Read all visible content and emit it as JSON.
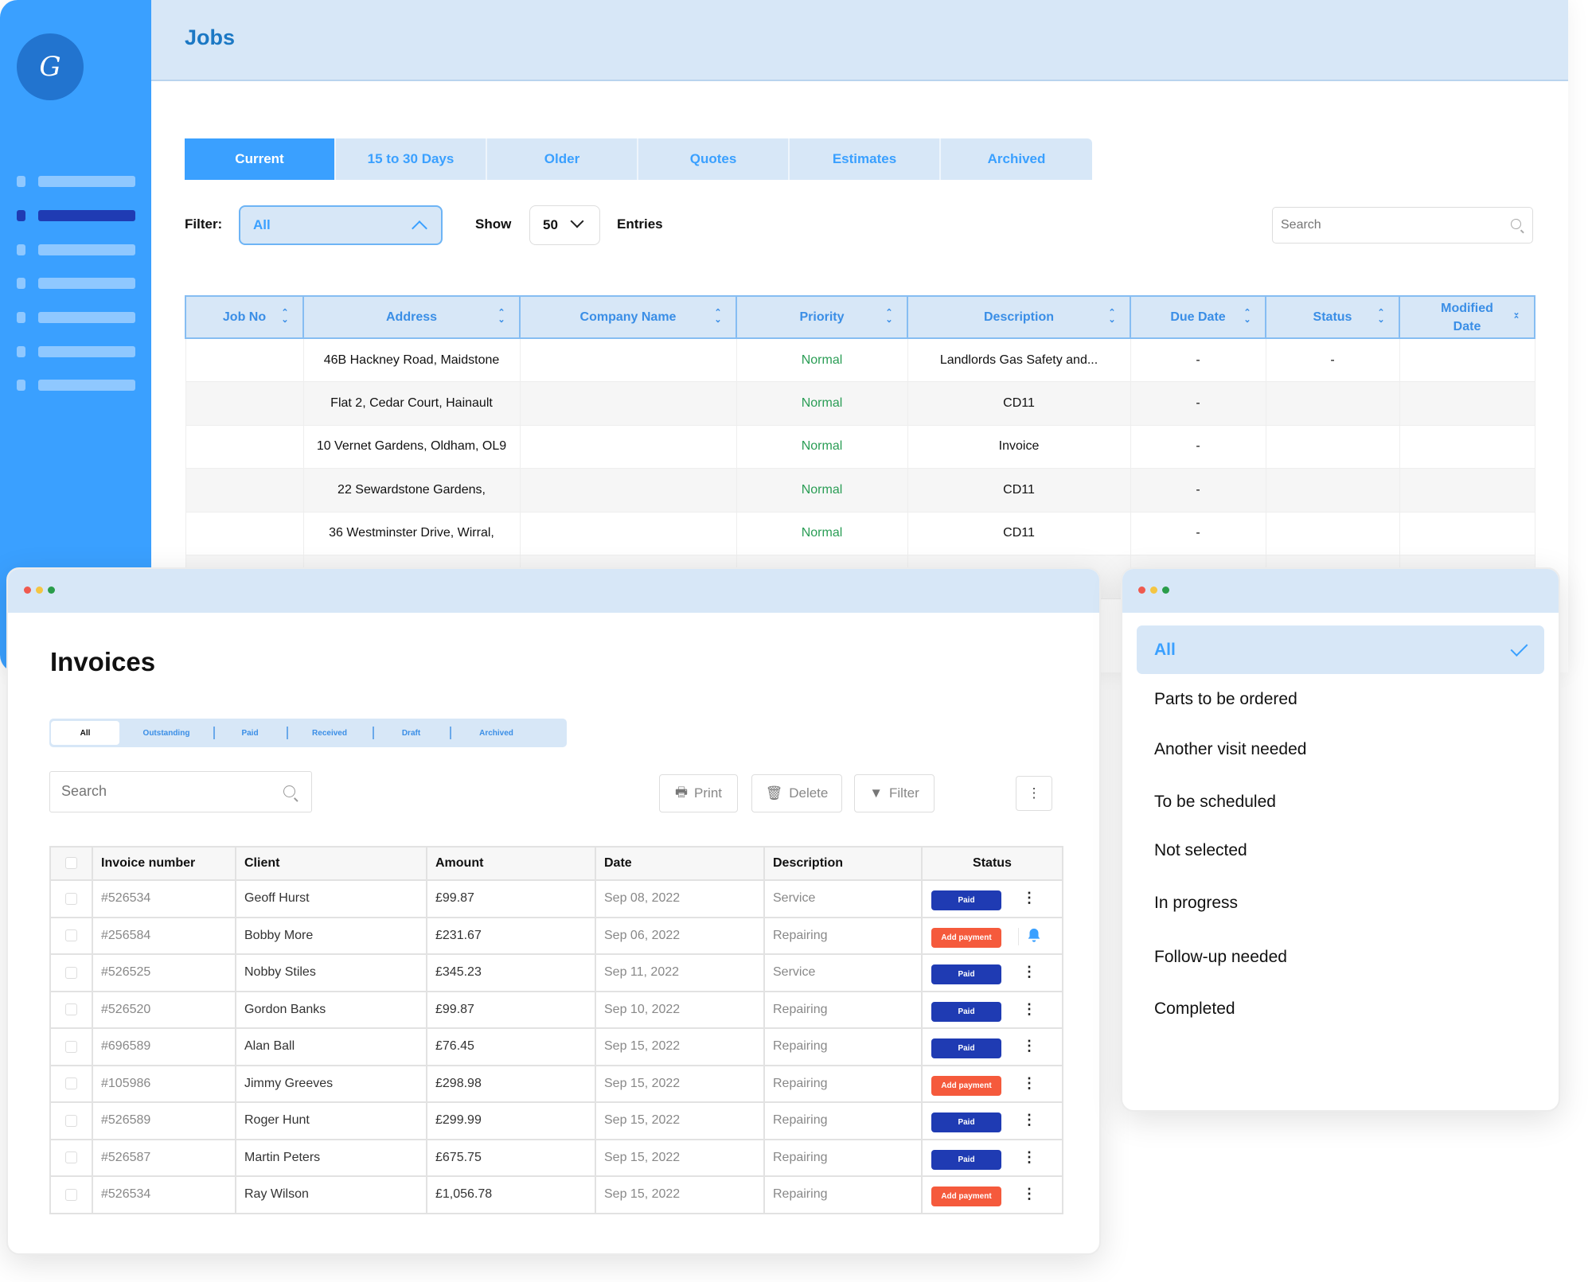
{
  "jobs_app": {
    "title": "Jobs",
    "logo_text": "G",
    "sidebar": {
      "items": [
        {
          "active": false
        },
        {
          "active": true
        },
        {
          "active": false
        },
        {
          "active": false
        },
        {
          "active": false
        },
        {
          "active": false
        },
        {
          "active": false
        }
      ]
    },
    "tabs": [
      {
        "label": "Current",
        "active": true
      },
      {
        "label": "15 to 30 Days",
        "active": false
      },
      {
        "label": "Older",
        "active": false
      },
      {
        "label": "Quotes",
        "active": false
      },
      {
        "label": "Estimates",
        "active": false
      },
      {
        "label": "Archived",
        "active": false
      }
    ],
    "filter": {
      "label": "Filter:",
      "value": "All"
    },
    "show": {
      "label": "Show",
      "value": "50",
      "suffix": "Entries"
    },
    "search": {
      "placeholder": "Search"
    },
    "table": {
      "columns": [
        "Job No",
        "Address",
        "Company Name",
        "Priority",
        "Description",
        "Due Date",
        "Status",
        "Modified Date"
      ],
      "rows": [
        {
          "job_no": "",
          "address": "46B Hackney Road, Maidstone",
          "company": "",
          "priority": "Normal",
          "description": "Landlords Gas Safety and...",
          "due_date": "-",
          "status": "-",
          "modified": ""
        },
        {
          "job_no": "",
          "address": "Flat 2, Cedar Court, Hainault",
          "company": "",
          "priority": "Normal",
          "description": "CD11",
          "due_date": "-",
          "status": "",
          "modified": ""
        },
        {
          "job_no": "",
          "address": "10 Vernet Gardens, Oldham, OL9",
          "company": "",
          "priority": "Normal",
          "description": "Invoice",
          "due_date": "-",
          "status": "",
          "modified": ""
        },
        {
          "job_no": "",
          "address": "22 Sewardstone Gardens,",
          "company": "",
          "priority": "Normal",
          "description": "CD11",
          "due_date": "-",
          "status": "",
          "modified": ""
        },
        {
          "job_no": "",
          "address": "36 Westminster Drive, Wirral,",
          "company": "",
          "priority": "Normal",
          "description": "CD11",
          "due_date": "-",
          "status": "",
          "modified": ""
        },
        {
          "job_no": "",
          "address": "",
          "company": "",
          "priority": "",
          "description": "",
          "due_date": "",
          "status": "",
          "modified": ""
        }
      ]
    }
  },
  "invoices": {
    "title": "Invoices",
    "tabs": [
      {
        "label": "All",
        "active": true
      },
      {
        "label": "Outstanding",
        "active": false
      },
      {
        "label": "Paid",
        "active": false
      },
      {
        "label": "Received",
        "active": false
      },
      {
        "label": "Draft",
        "active": false
      },
      {
        "label": "Archived",
        "active": false
      }
    ],
    "search": {
      "placeholder": "Search"
    },
    "toolbar": {
      "print": "Print",
      "delete": "Delete",
      "filter": "Filter",
      "more": "⋮"
    },
    "table": {
      "columns": [
        "Invoice number",
        "Client",
        "Amount",
        "Date",
        "Description",
        "Status"
      ],
      "rows": [
        {
          "number": "#526534",
          "client": "Geoff Hurst",
          "amount": "£99.87",
          "date": "Sep 08, 2022",
          "description": "Service",
          "status": "Paid",
          "action": "menu"
        },
        {
          "number": "#256584",
          "client": "Bobby More",
          "amount": "£231.67",
          "date": "Sep 06, 2022",
          "description": "Repairing",
          "status": "Add payment",
          "action": "bell"
        },
        {
          "number": "#526525",
          "client": "Nobby Stiles",
          "amount": "£345.23",
          "date": "Sep 11, 2022",
          "description": "Service",
          "status": "Paid",
          "action": "menu"
        },
        {
          "number": "#526520",
          "client": "Gordon Banks",
          "amount": "£99.87",
          "date": "Sep 10, 2022",
          "description": "Repairing",
          "status": "Paid",
          "action": "menu"
        },
        {
          "number": "#696589",
          "client": "Alan Ball",
          "amount": "£76.45",
          "date": "Sep 15, 2022",
          "description": "Repairing",
          "status": "Paid",
          "action": "menu"
        },
        {
          "number": "#105986",
          "client": "Jimmy Greeves",
          "amount": "£298.98",
          "date": "Sep 15, 2022",
          "description": "Repairing",
          "status": "Add payment",
          "action": "menu"
        },
        {
          "number": "#526589",
          "client": "Roger Hunt",
          "amount": "£299.99",
          "date": "Sep 15, 2022",
          "description": "Repairing",
          "status": "Paid",
          "action": "menu"
        },
        {
          "number": "#526587",
          "client": "Martin Peters",
          "amount": "£675.75",
          "date": "Sep 15, 2022",
          "description": "Repairing",
          "status": "Paid",
          "action": "menu"
        },
        {
          "number": "#526534",
          "client": "Ray Wilson",
          "amount": "£1,056.78",
          "date": "Sep 15, 2022",
          "description": "Repairing",
          "status": "Add payment",
          "action": "menu"
        }
      ]
    }
  },
  "status_dropdown": {
    "options": [
      {
        "label": "All",
        "selected": true
      },
      {
        "label": "Parts to be ordered",
        "selected": false
      },
      {
        "label": "Another visit needed",
        "selected": false
      },
      {
        "label": "To be scheduled",
        "selected": false
      },
      {
        "label": "Not selected",
        "selected": false
      },
      {
        "label": "In progress",
        "selected": false
      },
      {
        "label": "Follow-up needed",
        "selected": false
      },
      {
        "label": "Completed",
        "selected": false
      }
    ]
  },
  "colors": {
    "primary": "#3aa0ff",
    "light": "#d7e7f7",
    "paid": "#1f3bb3",
    "add_payment": "#f55a3c",
    "priority_normal": "#2a9d55"
  }
}
